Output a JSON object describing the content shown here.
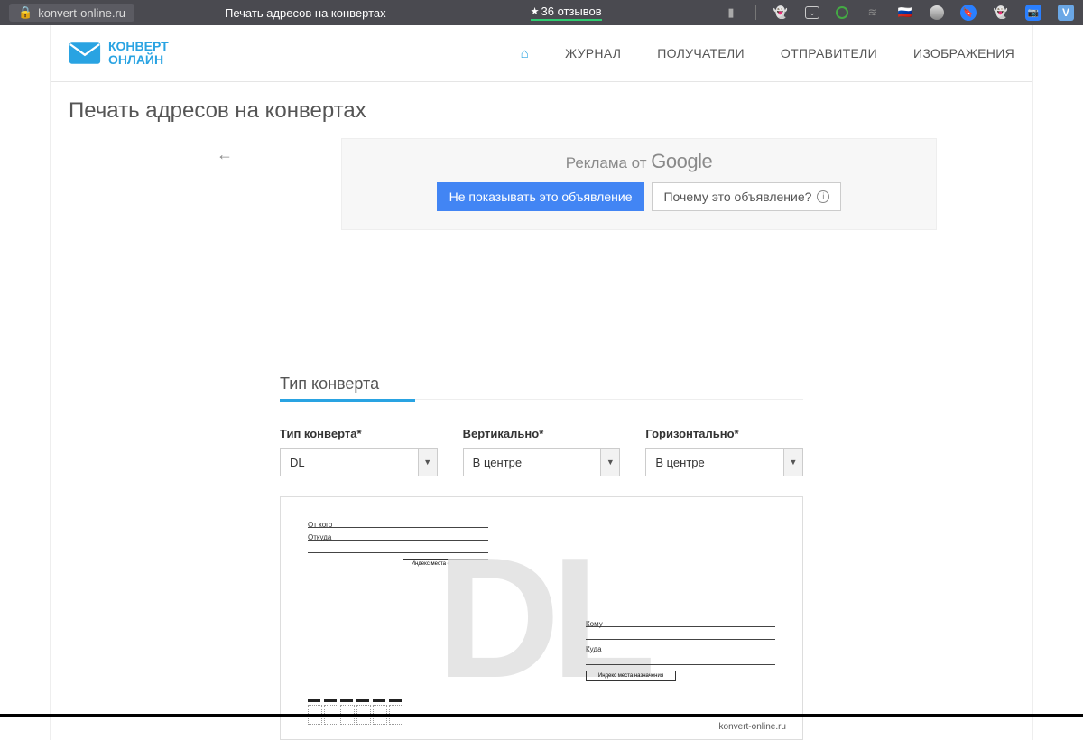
{
  "browser": {
    "url_host": "konvert-online.ru",
    "tab_title": "Печать адресов на конвертах",
    "reviews_text": "36 отзывов"
  },
  "logo": {
    "line1": "КОНВЕРТ",
    "line2": "ОНЛАЙН"
  },
  "nav": {
    "journal": "ЖУРНАЛ",
    "recipients": "ПОЛУЧАТЕЛИ",
    "senders": "ОТПРАВИТЕЛИ",
    "images": "ИЗОБРАЖЕНИЯ"
  },
  "page_title": "Печать адресов на конвертах",
  "ad": {
    "label_prefix": "Реклама от ",
    "google": "Google",
    "hide_btn": "Не показывать это объявление",
    "why_btn": "Почему это объявление?"
  },
  "section_title": "Тип конверта",
  "fields": {
    "type": {
      "label": "Тип конверта*",
      "value": "DL"
    },
    "vertical": {
      "label": "Вертикально*",
      "value": "В центре"
    },
    "horizontal": {
      "label": "Горизонтально*",
      "value": "В центре"
    }
  },
  "envelope": {
    "watermark": "DL",
    "from_label": "От кого",
    "from_where_label": "Откуда",
    "sender_index_label": "Индекс места отправления",
    "to_label": "Кому",
    "to_where_label": "Куда",
    "recip_index_label": "Индекс места назначения",
    "brand": "konvert-online.ru"
  }
}
